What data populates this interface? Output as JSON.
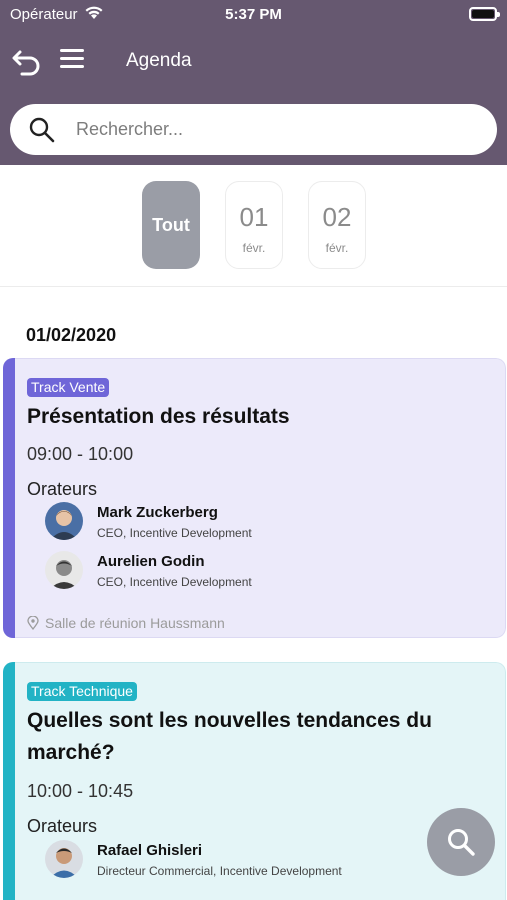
{
  "status_bar": {
    "carrier": "Opérateur",
    "time": "5:37 PM"
  },
  "nav": {
    "title": "Agenda"
  },
  "search": {
    "placeholder": "Rechercher..."
  },
  "date_filter": {
    "all_label": "Tout",
    "days": [
      {
        "num": "01",
        "month": "févr."
      },
      {
        "num": "02",
        "month": "févr."
      }
    ]
  },
  "agenda": {
    "section_date": "01/02/2020",
    "sessions": [
      {
        "track": "Track Vente",
        "track_color": "#6f66d8",
        "title": "Présentation des résultats",
        "time": "09:00 - 10:00",
        "speakers_label": "Orateurs",
        "speakers": [
          {
            "name": "Mark Zuckerberg",
            "role": "CEO, Incentive Development"
          },
          {
            "name": "Aurelien Godin",
            "role": "CEO, Incentive Development"
          }
        ],
        "location": "Salle de réunion Haussmann"
      },
      {
        "track": "Track Technique",
        "track_color": "#22b3c5",
        "title": "Quelles sont les nouvelles tendances du marché?",
        "time": "10:00 - 10:45",
        "speakers_label": "Orateurs",
        "speakers": [
          {
            "name": "Rafael Ghisleri",
            "role": "Directeur Commercial, Incentive Development"
          }
        ]
      }
    ]
  },
  "colors": {
    "header": "#665870",
    "chip_active": "#9a9da6"
  }
}
